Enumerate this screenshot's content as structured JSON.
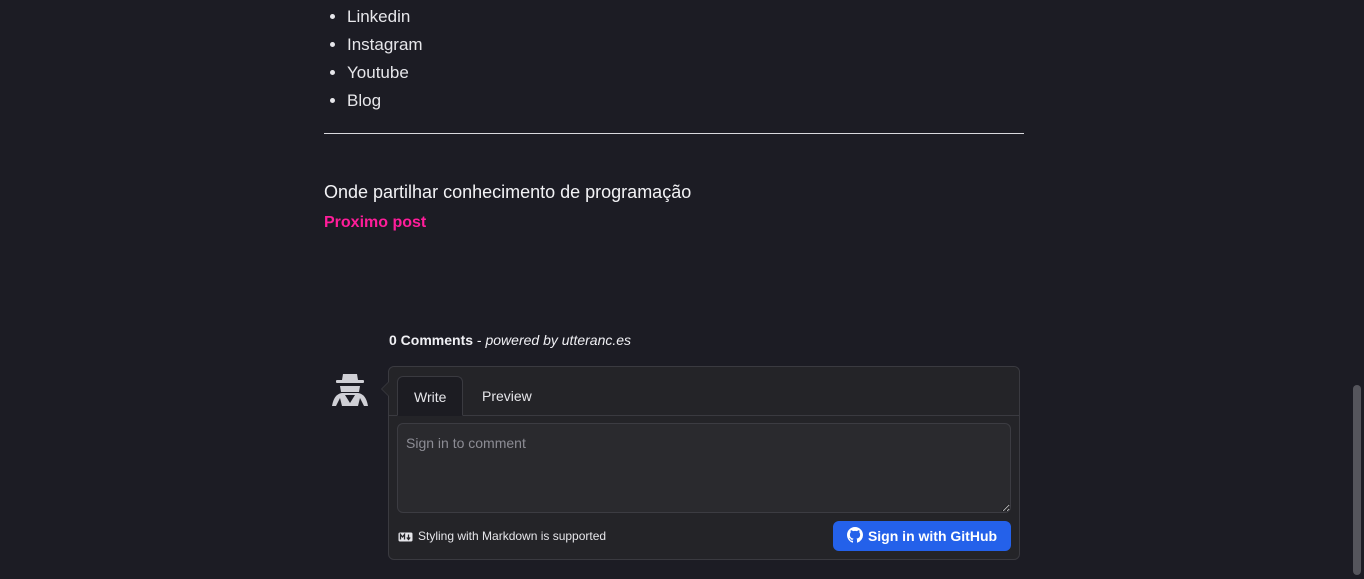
{
  "social_links": [
    {
      "label": "Linkedin"
    },
    {
      "label": "Instagram"
    },
    {
      "label": "Youtube"
    },
    {
      "label": "Blog"
    }
  ],
  "next_post": {
    "title": "Onde partilhar conhecimento de programação",
    "link_label": "Proximo post"
  },
  "comments": {
    "count_label": "0 Comments",
    "separator": " - ",
    "powered_prefix": "powered by ",
    "powered_link": "utteranc.es",
    "tabs": {
      "write": "Write",
      "preview": "Preview"
    },
    "textarea_placeholder": "Sign in to comment",
    "markdown_note": "Styling with Markdown is supported",
    "sign_in_button": "Sign in with GitHub"
  },
  "colors": {
    "background": "#1c1c24",
    "accent_link": "#ff1d9a",
    "github_button": "#2461ea"
  },
  "icons": {
    "avatar": "anonymous-user-icon",
    "markdown": "markdown-icon",
    "github": "github-icon"
  }
}
